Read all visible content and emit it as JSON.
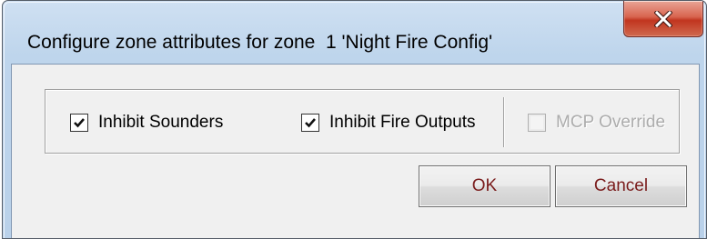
{
  "window": {
    "title": "Configure zone attributes for zone  1 'Night Fire Config'",
    "close_icon": "close-x-icon",
    "close_color": "#c7412c"
  },
  "options": {
    "inhibit_sounders": {
      "label": "Inhibit Sounders",
      "checked": true,
      "enabled": true
    },
    "inhibit_fire_outputs": {
      "label": "Inhibit Fire Outputs",
      "checked": true,
      "enabled": true
    },
    "mcp_override": {
      "label": "MCP Override",
      "checked": false,
      "enabled": false
    }
  },
  "buttons": {
    "ok_label": "OK",
    "cancel_label": "Cancel",
    "label_color": "#7a1c1c"
  }
}
